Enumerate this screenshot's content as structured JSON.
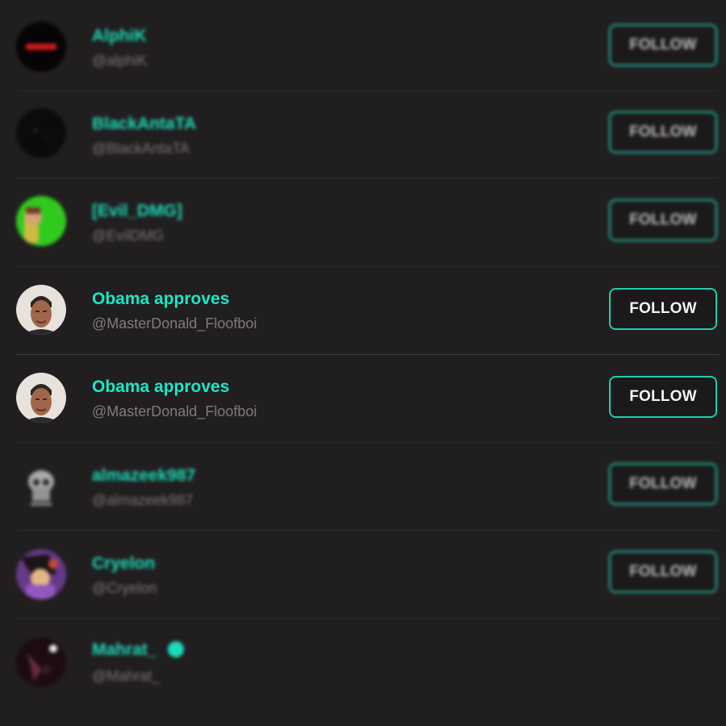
{
  "users": [
    {
      "name": "AlphiK",
      "handle": "@alphiK",
      "follow_label": "FOLLOW",
      "avatar_icon": "logo-avatar",
      "avatar_color": "#050304"
    },
    {
      "name": "BlackAntaTA",
      "handle": "@BlackAntaTA",
      "follow_label": "FOLLOW",
      "avatar_icon": "dark-avatar",
      "avatar_color": "#0a0a0a"
    },
    {
      "name": "[Evil_DMG]",
      "handle": "@EvilDMG",
      "follow_label": "FOLLOW",
      "avatar_icon": "cartoon-avatar",
      "avatar_color": "#2ed11a"
    },
    {
      "name": "Obama approves",
      "handle": "@MasterDonald_Floofboi",
      "follow_label": "FOLLOW",
      "avatar_icon": "photo-avatar",
      "avatar_color": "#b07a5c"
    },
    {
      "name": "Obama approves",
      "handle": "@MasterDonald_Floofboi",
      "follow_label": "FOLLOW",
      "avatar_icon": "photo-avatar",
      "avatar_color": "#b07a5c"
    },
    {
      "name": "almazeek987",
      "handle": "@almazeek987",
      "follow_label": "FOLLOW",
      "avatar_icon": "skull-avatar",
      "avatar_color": "#9a9a9a"
    },
    {
      "name": "Cryelon",
      "handle": "@Cryelon",
      "follow_label": "FOLLOW",
      "avatar_icon": "anime-avatar",
      "avatar_color": "#7a4aa0"
    },
    {
      "name": "Mahrat_",
      "handle": "@Mahrat_",
      "follow_label": "",
      "avatar_icon": "dark-art-avatar",
      "avatar_color": "#2a0f18"
    }
  ],
  "colors": {
    "accent": "#1de6c3",
    "background": "#211e20"
  }
}
